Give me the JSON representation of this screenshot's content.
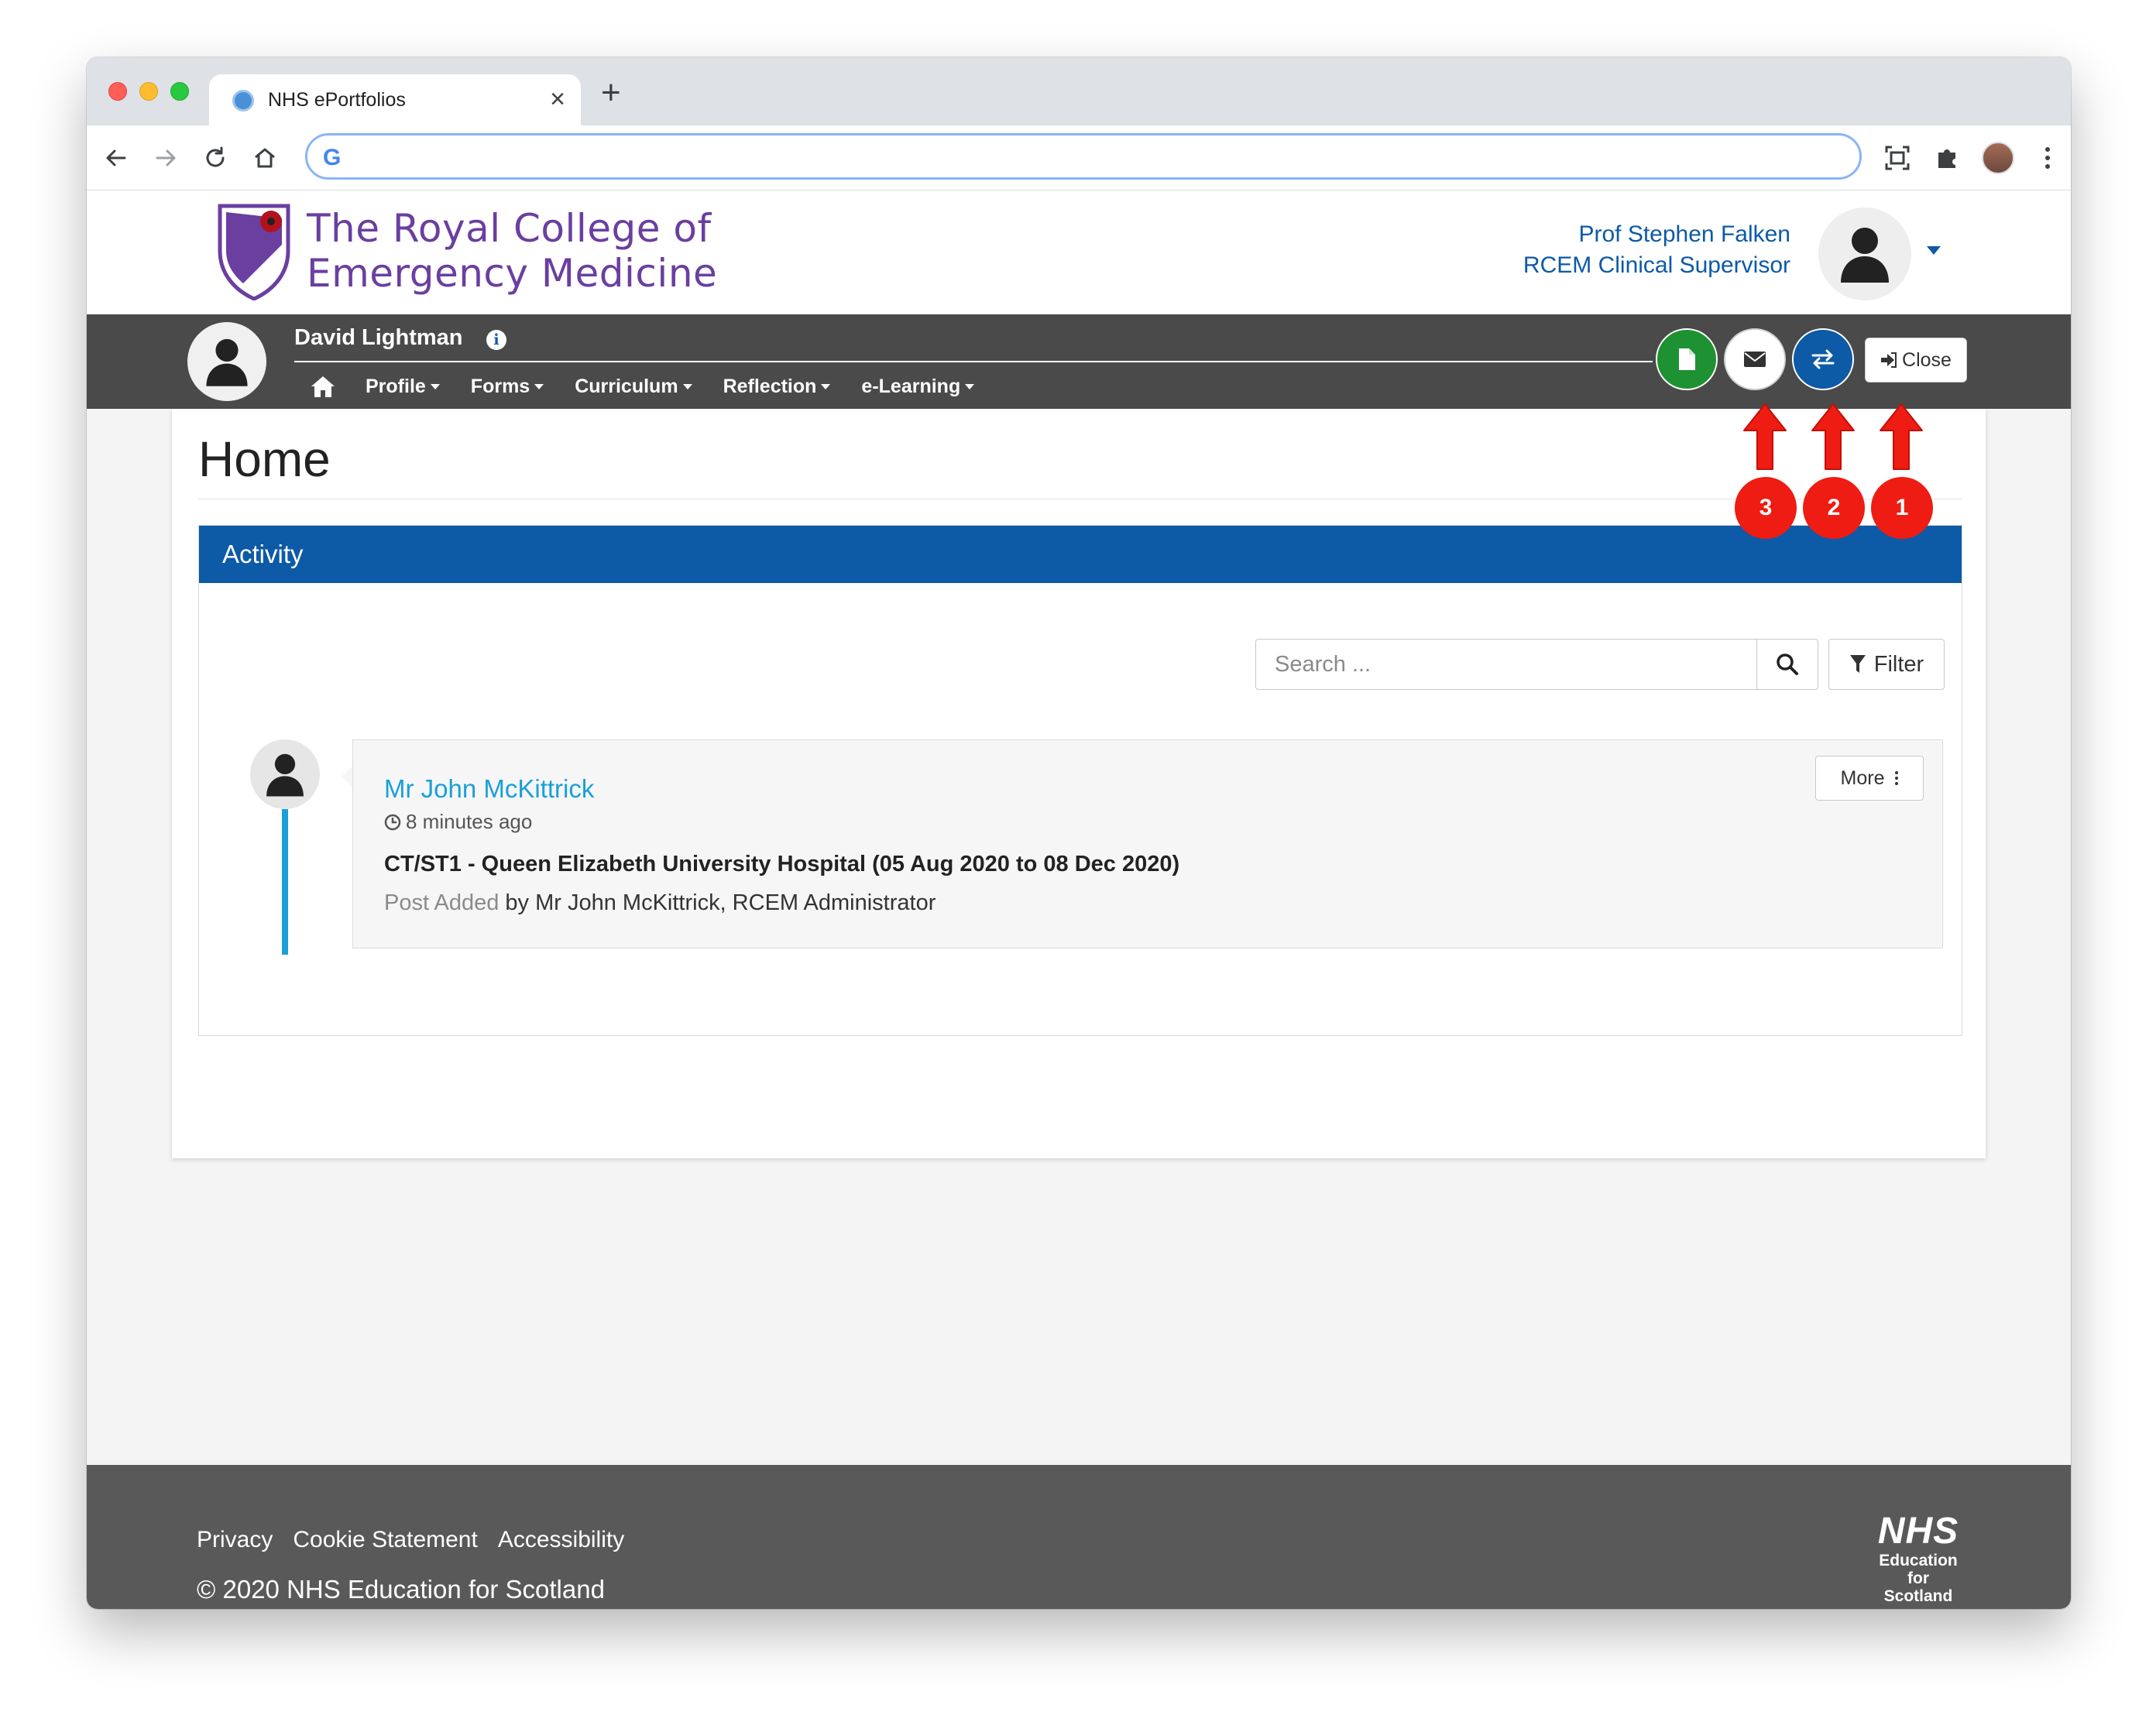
{
  "browser": {
    "tab_title": "NHS ePortfolios",
    "tab_close": "×",
    "new_tab": "+",
    "omnibox_value": ""
  },
  "header": {
    "college_line1": "The Royal College of",
    "college_line2": "Emergency Medicine",
    "user_name": "Prof Stephen Falken",
    "user_role": "RCEM Clinical Supervisor"
  },
  "trainee": {
    "name": "David Lightman",
    "info_glyph": "i",
    "menu": [
      {
        "label": "Profile"
      },
      {
        "label": "Forms"
      },
      {
        "label": "Curriculum"
      },
      {
        "label": "Reflection"
      },
      {
        "label": "e-Learning"
      }
    ],
    "close_label": "Close"
  },
  "main": {
    "title": "Home",
    "activity": {
      "title": "Activity",
      "search_placeholder": "Search ...",
      "filter_label": "Filter",
      "entries": [
        {
          "author": "Mr John McKittrick",
          "time": "8 minutes ago",
          "heading": "CT/ST1 - Queen Elizabeth University Hospital (05 Aug 2020 to 08 Dec 2020)",
          "type": "Post Added",
          "detail": "by Mr John McKittrick, RCEM Administrator",
          "more_label": "More"
        }
      ]
    }
  },
  "footer": {
    "links": [
      "Privacy",
      "Cookie Statement",
      "Accessibility"
    ],
    "copyright": "© 2020 NHS Education for Scotland",
    "nhs_mark": "NHS",
    "nhs_sub1": "Education",
    "nhs_sub2": "for",
    "nhs_sub3": "Scotland"
  },
  "annotations": [
    {
      "label": "3"
    },
    {
      "label": "2"
    },
    {
      "label": "1"
    }
  ],
  "colors": {
    "brand_blue": "#0d5aa7",
    "link_blue": "#1a9fd9",
    "doc_green": "#1e9132",
    "college_purple": "#6a3fa0",
    "annotation_red": "#ee1c12",
    "trainee_bar": "#4a4a4a",
    "footer": "#595959"
  },
  "icons": {
    "tab_favicon": "globe-icon",
    "back": "arrow-left-icon",
    "forward": "arrow-right-icon",
    "reload": "reload-icon",
    "home": "home-icon",
    "screenshot": "screen-capture-icon",
    "extensions": "puzzle-icon",
    "menu": "kebab-menu-icon",
    "document": "document-icon",
    "mail": "envelope-icon",
    "swap": "swap-arrows-icon",
    "close": "sign-out-icon",
    "search": "magnifier-icon",
    "filter": "funnel-icon",
    "clock": "clock-icon",
    "user": "user-silhouette-icon"
  }
}
